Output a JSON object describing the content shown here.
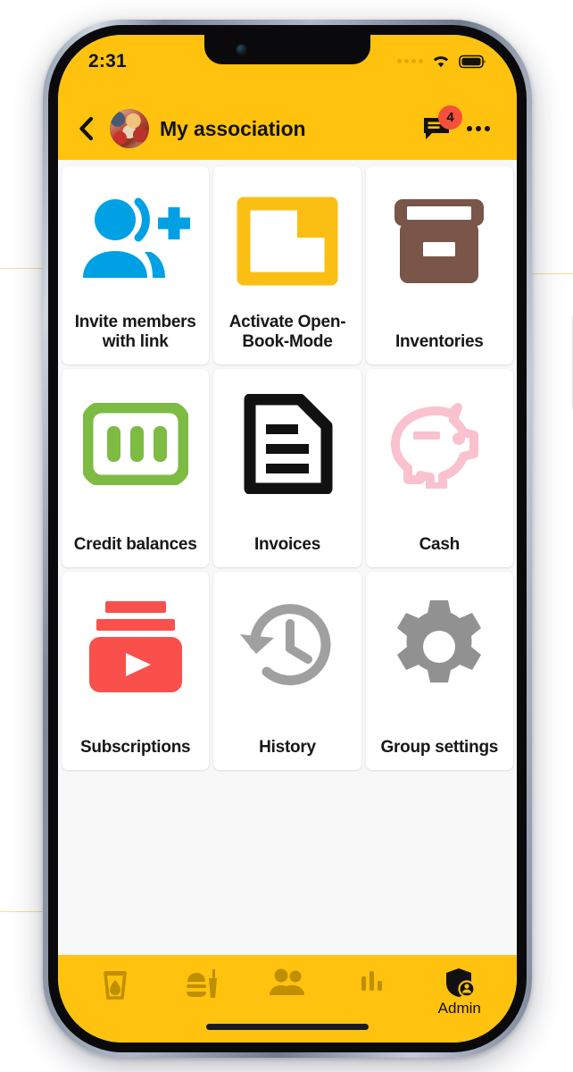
{
  "statusbar": {
    "time": "2:31",
    "signal_icon": "signal-dots-icon",
    "wifi_icon": "wifi-icon",
    "battery_icon": "battery-full-icon"
  },
  "header": {
    "back_icon": "chevron-left-icon",
    "avatar": "group-avatar",
    "title": "My association",
    "chat_icon": "chat-bubble-icon",
    "badge_count": "4",
    "more_icon": "more-options-icon"
  },
  "colors": {
    "brand_yellow": "#FFC20E",
    "badge_red": "#F4503C",
    "card_white": "#FFFFFF",
    "page_bg": "#F8F8F8",
    "invite_blue": "#00A0E4",
    "folder_yellow": "#FBBF14",
    "inventory_brown": "#79554A",
    "credit_green": "#7DBB42",
    "invoice_black": "#111111",
    "cash_pink": "#F9C2CE",
    "subscriptions_red": "#F9504B",
    "history_gray": "#A0A0A0",
    "settings_gray": "#919191",
    "nav_icon_gold": "#C08F00"
  },
  "grid": {
    "tiles": [
      {
        "label": "Invite members with link",
        "icon": "person-add-icon"
      },
      {
        "label": "Activate Open-Book-Mode",
        "icon": "open-folder-icon"
      },
      {
        "label": "Inventories",
        "icon": "archive-box-icon"
      },
      {
        "label": "Credit balances",
        "icon": "banknote-100-icon"
      },
      {
        "label": "Invoices",
        "icon": "document-lines-icon"
      },
      {
        "label": "Cash",
        "icon": "piggy-bank-icon"
      },
      {
        "label": "Subscriptions",
        "icon": "subscriptions-play-icon"
      },
      {
        "label": "History",
        "icon": "clock-rotate-left-icon"
      },
      {
        "label": "Group settings",
        "icon": "gear-icon"
      }
    ]
  },
  "bottomnav": {
    "items": [
      {
        "label": "",
        "icon": "drink-glass-icon",
        "active": false
      },
      {
        "label": "",
        "icon": "fast-food-icon",
        "active": false
      },
      {
        "label": "",
        "icon": "people-icon",
        "active": false
      },
      {
        "label": "",
        "icon": "bar-chart-icon",
        "active": false
      },
      {
        "label": "Admin",
        "icon": "shield-person-icon",
        "active": true
      }
    ]
  }
}
